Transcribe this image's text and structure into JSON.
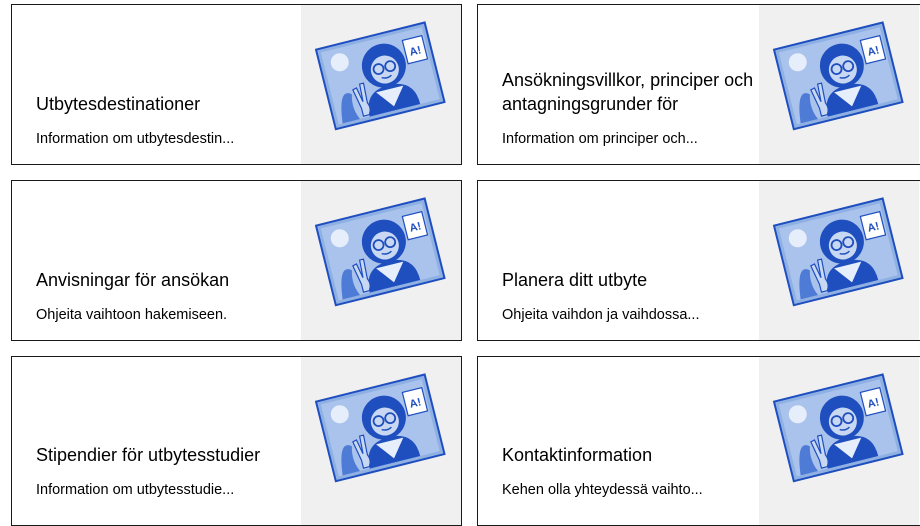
{
  "cards": [
    {
      "title": "Utbytesdestinationer",
      "description": "Information om utbytesdestin...",
      "icon": "student-illustration-icon"
    },
    {
      "title": "Ansökningsvillkor, principer och antagningsgrunder för",
      "description": "Information om principer och...",
      "icon": "student-illustration-icon"
    },
    {
      "title": "Anvisningar för ansökan",
      "description": "Ohjeita vaihtoon hakemiseen.",
      "icon": "student-illustration-icon"
    },
    {
      "title": "Planera ditt utbyte",
      "description": "Ohjeita vaihdon ja vaihdossa...",
      "icon": "student-illustration-icon"
    },
    {
      "title": "Stipendier för utbytesstudier",
      "description": "Information om utbytesstudie...",
      "icon": "student-illustration-icon"
    },
    {
      "title": "Kontaktinformation",
      "description": "Kehen olla yhteydessä vaihto...",
      "icon": "student-illustration-icon"
    }
  ],
  "illustration": {
    "badge_text": "A!",
    "colors": {
      "blue": "#1f4fbf",
      "light_blue": "#8fb0e3",
      "pale": "#c9d8f2"
    }
  }
}
